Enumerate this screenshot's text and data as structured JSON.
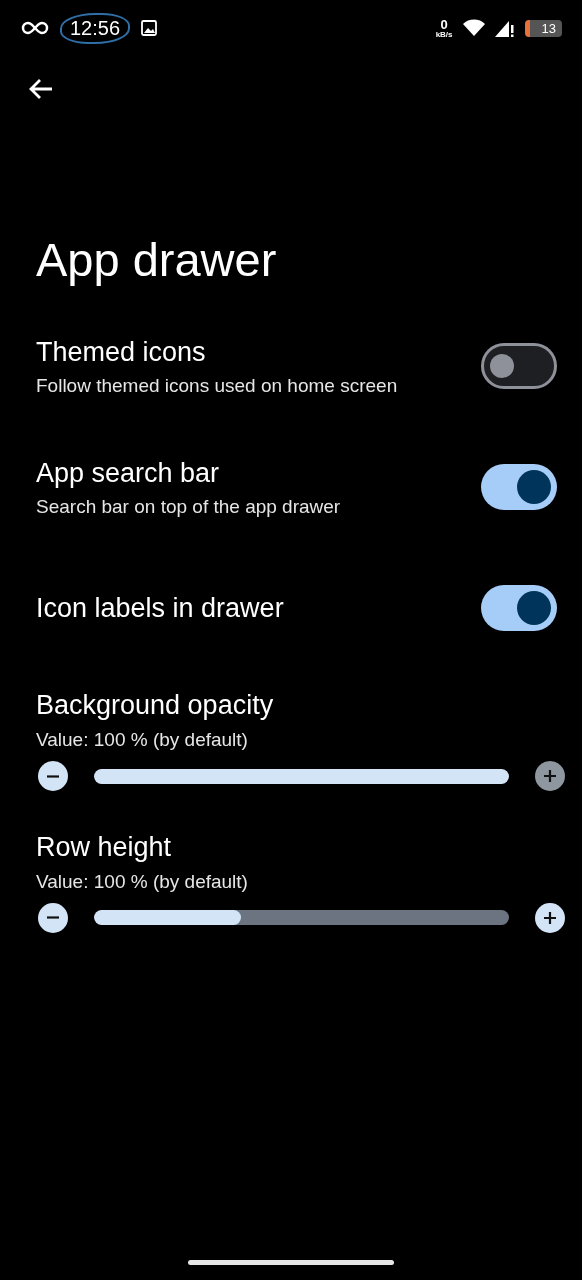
{
  "status_bar": {
    "time": "12:56",
    "speed_value": "0",
    "speed_unit": "kB/s",
    "battery": "13"
  },
  "title": "App drawer",
  "settings": [
    {
      "kind": "toggle",
      "title": "Themed icons",
      "subtitle": "Follow themed icons used on home screen",
      "on": false
    },
    {
      "kind": "toggle",
      "title": "App search bar",
      "subtitle": "Search bar on top of the app drawer",
      "on": true
    },
    {
      "kind": "toggle",
      "title": "Icon labels in drawer",
      "on": true
    },
    {
      "kind": "slider",
      "title": "Background opacity",
      "subtitle": "Value: 100 % (by default)",
      "level": 1.0,
      "minus_disabled": false,
      "plus_disabled": true
    },
    {
      "kind": "slider",
      "title": "Row height",
      "subtitle": "Value: 100 % (by default)",
      "level": 0.355,
      "minus_disabled": false,
      "plus_disabled": false
    }
  ]
}
